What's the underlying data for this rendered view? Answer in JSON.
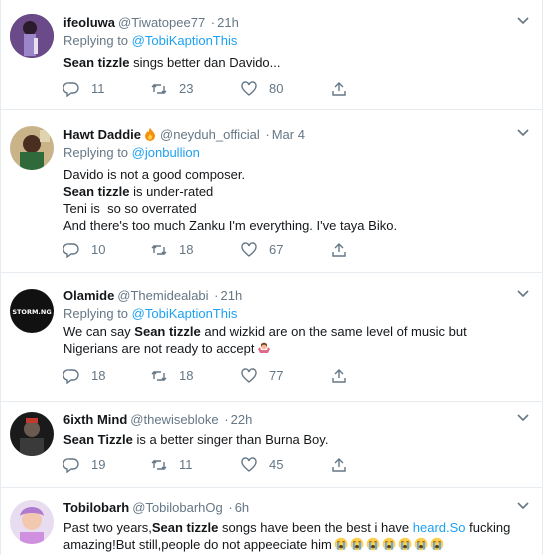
{
  "tweets": [
    {
      "name": "ifeoluwa",
      "handle": "@Tiwatopee77",
      "time": "21h",
      "reply_prefix": "Replying to",
      "mention": "@TobiKaptionThis",
      "text": {
        "bold": "Sean tizzle",
        "rest": " sings better dan Davido..."
      },
      "replies": "11",
      "retweets": "23",
      "likes": "80"
    },
    {
      "name": "Hawt Daddie",
      "name_emoji": "fire-emoji",
      "handle": "@neyduh_official",
      "time": "Mar 4",
      "reply_prefix": "Replying to",
      "mention": "@jonbullion",
      "lines": [
        {
          "text": "Davido is not a good composer."
        },
        {
          "bold": "Sean tizzle",
          "text": " is under-rated"
        },
        {
          "text": "Teni is  so so overrated"
        },
        {
          "text": "And there's too much Zanku I'm everything. I've taya Biko."
        }
      ],
      "replies": "10",
      "retweets": "18",
      "likes": "67"
    },
    {
      "name": "Olamide",
      "handle": "@Themidealabi",
      "time": "21h",
      "reply_prefix": "Replying to",
      "mention": "@TobiKaptionThis",
      "avatar_label": "STORM.NG",
      "text_a": "We can say ",
      "bold": "Sean tizzle",
      "text_b": " and wizkid are on the same level of music but",
      "text_c": "Nigerians are not ready to accept",
      "emoji": "person-shrugging-emoji",
      "replies": "18",
      "retweets": "18",
      "likes": "77"
    },
    {
      "name": "6ixth Mind",
      "handle": "@thewisebloke",
      "time": "22h",
      "bold": "Sean Tizzle",
      "text": " is a better singer than Burna Boy.",
      "replies": "19",
      "retweets": "11",
      "likes": "45"
    },
    {
      "name": "Tobilobarh",
      "handle": "@TobilobarhOg",
      "time": "6h",
      "text_a": "Past two years,",
      "bold": "Sean tizzle",
      "text_b": " songs have been the best i have ",
      "link": "heard.So",
      "text_c": " fucking",
      "text_d": "amazing!But still,people do not appeeciate him",
      "emoji": "loudly-crying-face-emoji",
      "emoji_count": 7
    }
  ],
  "dot": "·",
  "colors": {
    "accent": "#1da1f2",
    "muted": "#657786",
    "text": "#14171a",
    "divider": "#e6ecf0"
  }
}
